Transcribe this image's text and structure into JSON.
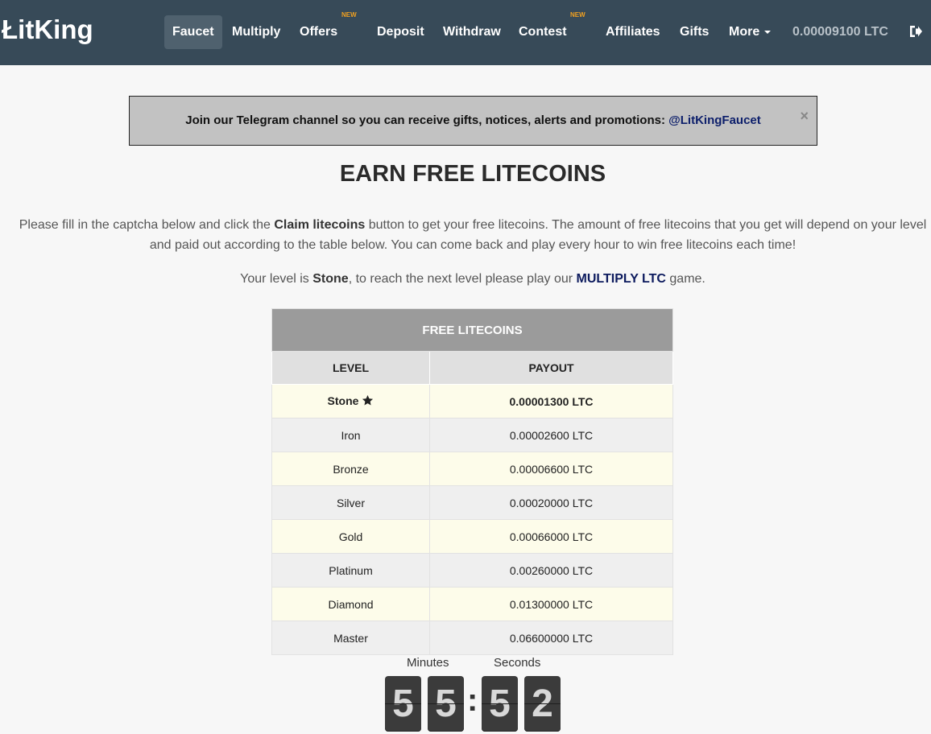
{
  "brand": "ŁitKing",
  "nav": {
    "faucet": "Faucet",
    "multiply": "Multiply",
    "offers": "Offers",
    "offers_badge": "NEW",
    "deposit": "Deposit",
    "withdraw": "Withdraw",
    "contest": "Contest",
    "contest_badge": "NEW",
    "affiliates": "Affiliates",
    "gifts": "Gifts",
    "more": "More",
    "balance": "0.00009100 LTC",
    "logout_icon": "sign-out-icon"
  },
  "alert": {
    "text": "Join our Telegram channel so you can receive gifts, notices, alerts and promotions: ",
    "link": "@LitKingFaucet",
    "close": "×"
  },
  "title": "EARN FREE LITECOINS",
  "desc": {
    "part1": "Please fill in the captcha below and click the ",
    "bold": "Claim litecoins",
    "part2": " button to get your free litecoins. The amount of free litecoins that you get will depend on your level and paid out according to the table below. You can come back and play every hour to win free litecoins each time!"
  },
  "level_line": {
    "part1": "Your level is ",
    "level": "Stone",
    "part2": ", to reach the next level please play our ",
    "link": "MULTIPLY LTC",
    "part3": " game."
  },
  "table": {
    "title": "FREE LITECOINS",
    "col_level": "LEVEL",
    "col_payout": "PAYOUT",
    "rows": [
      {
        "level": "Stone",
        "payout": "0.00001300 LTC"
      },
      {
        "level": "Iron",
        "payout": "0.00002600 LTC"
      },
      {
        "level": "Bronze",
        "payout": "0.00006600 LTC"
      },
      {
        "level": "Silver",
        "payout": "0.00020000 LTC"
      },
      {
        "level": "Gold",
        "payout": "0.00066000 LTC"
      },
      {
        "level": "Platinum",
        "payout": "0.00260000 LTC"
      },
      {
        "level": "Diamond",
        "payout": "0.01300000 LTC"
      },
      {
        "level": "Master",
        "payout": "0.06600000 LTC"
      }
    ]
  },
  "countdown": {
    "minutes_label": "Minutes",
    "seconds_label": "Seconds",
    "m1": "5",
    "m2": "5",
    "sep": ":",
    "s1": "5",
    "s2": "2"
  }
}
